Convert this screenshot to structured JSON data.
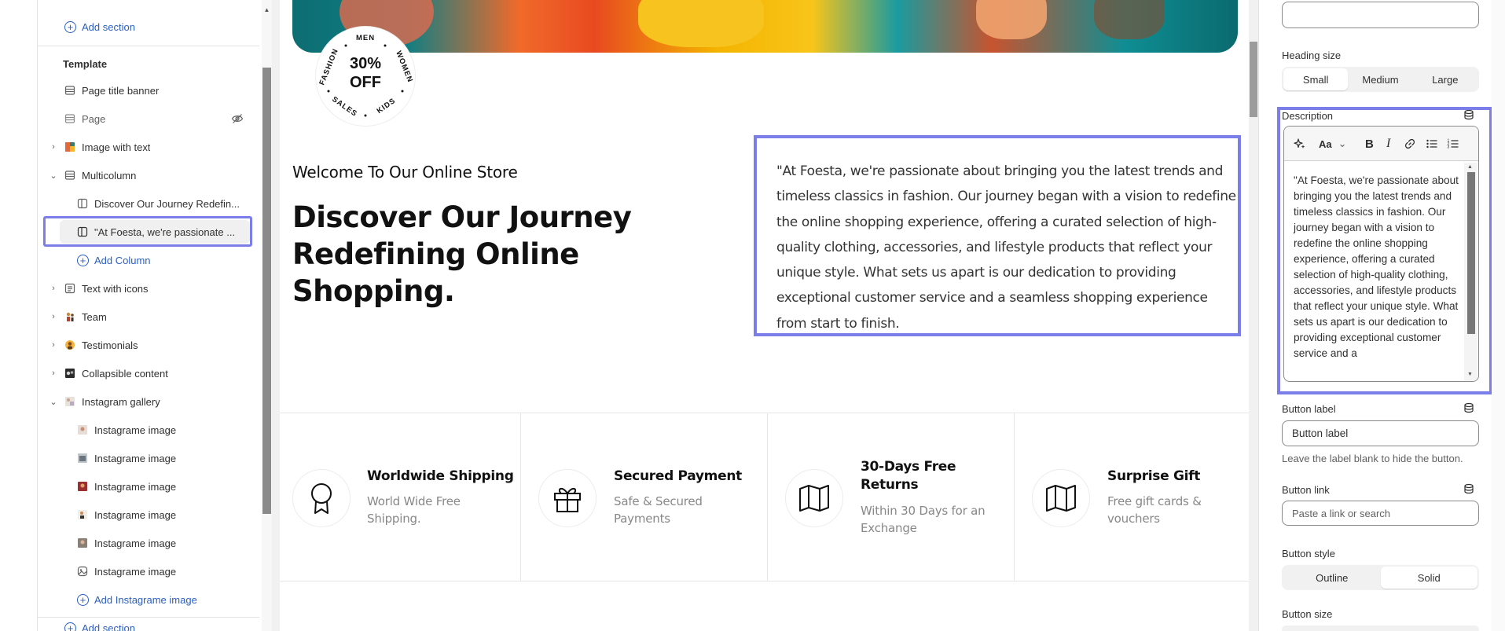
{
  "left_panel": {
    "add_section_top": "Add section",
    "template_heading": "Template",
    "items": [
      {
        "label": "Page title banner"
      },
      {
        "label": "Page"
      },
      {
        "label": "Image with text"
      },
      {
        "label": "Multicolumn"
      },
      {
        "label": "Discover Our Journey Redefin..."
      },
      {
        "label": "\"At Foesta, we're passionate ..."
      },
      {
        "label": "Add Column"
      },
      {
        "label": "Text with icons"
      },
      {
        "label": "Team"
      },
      {
        "label": "Testimonials"
      },
      {
        "label": "Collapsible content"
      },
      {
        "label": "Instagram gallery"
      },
      {
        "label": "Instagrame image"
      },
      {
        "label": "Instagrame image"
      },
      {
        "label": "Instagrame image"
      },
      {
        "label": "Instagrame image"
      },
      {
        "label": "Instagrame image"
      },
      {
        "label": "Instagrame image"
      },
      {
        "label": "Add Instagrame image"
      }
    ],
    "add_section_bottom": "Add section"
  },
  "preview": {
    "badge": {
      "line1": "30%",
      "line2": "OFF",
      "ring_words": [
        "MEN",
        "WOMEN",
        "KIDS",
        "SALES",
        "FASHION"
      ]
    },
    "welcome": "Welcome To Our Online Store",
    "heading": "Discover Our Journey Redefining Online Shopping.",
    "description": "\"At Foesta, we're passionate about bringing you the latest trends and timeless classics in fashion. Our journey began with a vision to redefine the online shopping experience, offering a curated selection of high-quality clothing, accessories, and lifestyle products that reflect your unique style. What sets us apart is our dedication to providing exceptional customer service and a seamless shopping experience from start to finish.",
    "features": [
      {
        "title": "Worldwide Shipping",
        "subtitle": "World Wide Free Shipping.",
        "icon": "award-ribbon-icon"
      },
      {
        "title": "Secured Payment",
        "subtitle": "Safe & Secured Payments",
        "icon": "gift-icon"
      },
      {
        "title": "30-Days Free Returns",
        "subtitle": "Within 30 Days for an Exchange",
        "icon": "map-icon"
      },
      {
        "title": "Surprise Gift",
        "subtitle": "Free gift cards & vouchers",
        "icon": "map-icon"
      }
    ]
  },
  "right_panel": {
    "heading_size_label": "Heading size",
    "heading_size_options": [
      "Small",
      "Medium",
      "Large"
    ],
    "heading_size_selected": "Small",
    "description_label": "Description",
    "description_text": "\"At Foesta, we're passionate about bringing you the latest trends and timeless classics in fashion. Our journey began with a vision to redefine the online shopping experience, offering a curated selection of high-quality clothing, accessories, and lifestyle products that reflect your unique style. What sets us apart is our dedication to providing exceptional customer service and a",
    "toolbar": {
      "font_label": "Aa"
    },
    "button_label_label": "Button label",
    "button_label_value": "Button label",
    "button_label_help": "Leave the label blank to hide the button.",
    "button_link_label": "Button link",
    "button_link_placeholder": "Paste a link or search",
    "button_style_label": "Button style",
    "button_style_options": [
      "Outline",
      "Solid"
    ],
    "button_style_selected": "Solid",
    "button_size_label": "Button size"
  },
  "colors": {
    "highlight": "#7b7de8",
    "link": "#2a5ec4"
  }
}
